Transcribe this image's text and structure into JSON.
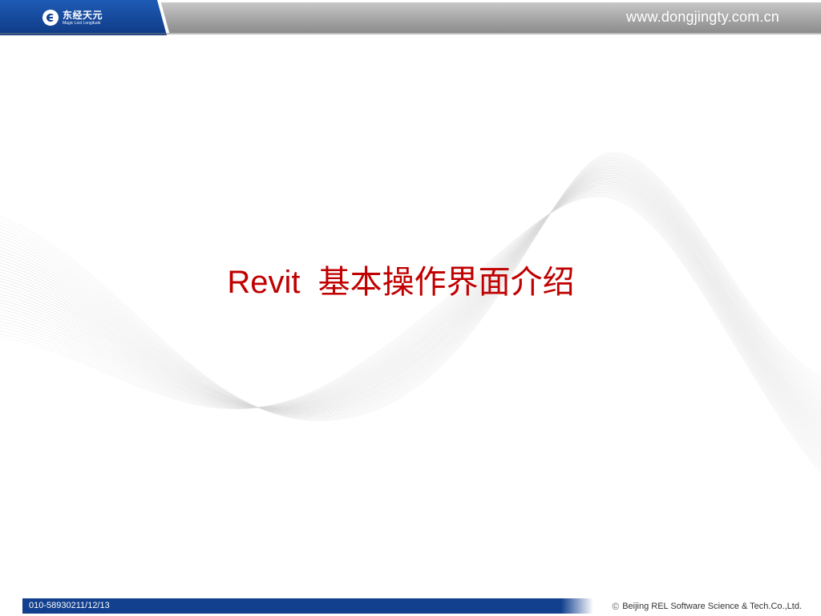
{
  "header": {
    "logo": {
      "name_cn": "东经天元",
      "name_en": "Magic Lost Longitude",
      "icon": "company-logo-icon"
    },
    "url": "www.dongjingty.com.cn"
  },
  "slide": {
    "title": "Revit  基本操作界面介绍"
  },
  "footer": {
    "phone": "010-58930211/12/13",
    "copyright_icon": "copyright-icon",
    "copyright_symbol": "©",
    "copyright": "Beijing REL Software Science & Tech.Co.,Ltd."
  },
  "colors": {
    "brand_blue": "#12408e",
    "header_gray": "#9a9a9a",
    "title_red": "#c00000",
    "wave_gray": "#d8d8d8"
  }
}
